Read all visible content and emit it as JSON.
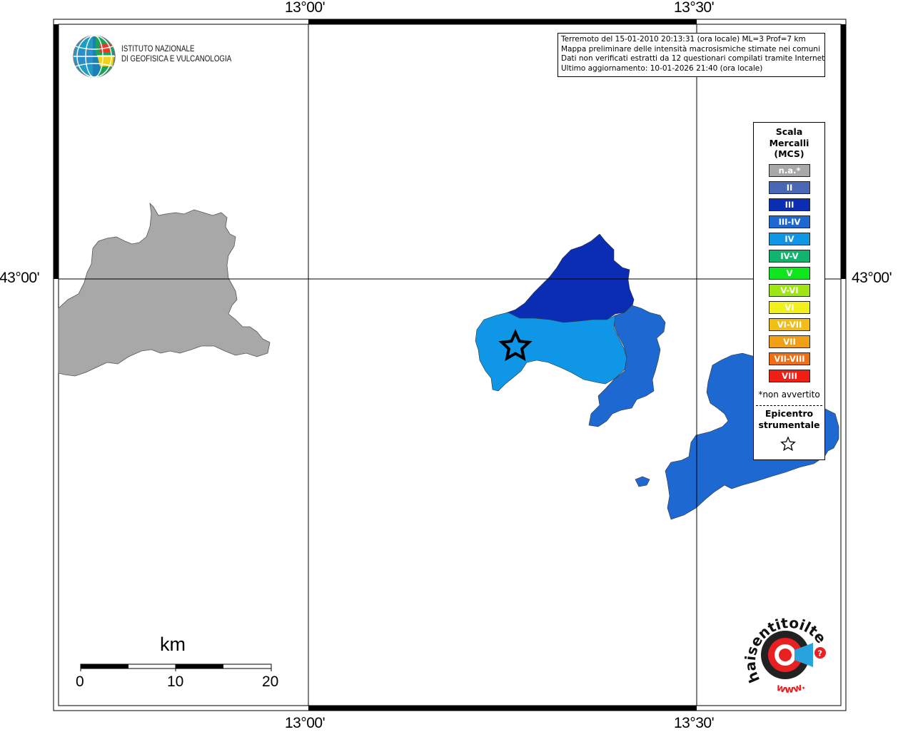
{
  "map": {
    "graticule": {
      "lon_labels": [
        "13°00'",
        "13°30'"
      ],
      "lat_labels": [
        "43°00'"
      ]
    },
    "colors": {
      "not_available": "#a8a8a8",
      "intensity_III": "#0a2db4",
      "intensity_III_IV": "#1e68d2",
      "intensity_IV": "#0f96e6",
      "epicenter_star": "#000000"
    },
    "regions": [
      {
        "name": "municipality-na",
        "intensity": "n.a."
      },
      {
        "name": "municipality-III",
        "intensity": "III"
      },
      {
        "name": "municipality-IV",
        "intensity": "IV"
      },
      {
        "name": "municipality-III-IV-east",
        "intensity": "III-IV"
      },
      {
        "name": "municipality-III-IV-southeast",
        "intensity": "III-IV"
      }
    ]
  },
  "info": {
    "line1": "Terremoto del 15-01-2010 20:13:31 (ora locale) ML=3 Prof=7 km",
    "line2": "Mappa preliminare delle intensità macrosismiche stimate nei comuni",
    "line3": "Dati non verificati estratti da 12 questionari compilati tramite Internet.",
    "line4": "Ultimo aggiornamento: 10-01-2026 21:40 (ora locale)"
  },
  "legend": {
    "title_line1": "Scala",
    "title_line2": "Mercalli",
    "title_line3": "(MCS)",
    "items": [
      {
        "label": "n.a.*",
        "color": "#a8a8a8"
      },
      {
        "label": "II",
        "color": "#4a67b5"
      },
      {
        "label": "III",
        "color": "#0a2db4"
      },
      {
        "label": "III-IV",
        "color": "#1e68d2"
      },
      {
        "label": "IV",
        "color": "#0f96e6"
      },
      {
        "label": "IV-V",
        "color": "#10b46e"
      },
      {
        "label": "V",
        "color": "#10e61e"
      },
      {
        "label": "V-VI",
        "color": "#a0e614"
      },
      {
        "label": "VI",
        "color": "#f0f01e"
      },
      {
        "label": "VI-VII",
        "color": "#f0be14"
      },
      {
        "label": "VII",
        "color": "#f0a014"
      },
      {
        "label": "VII-VIII",
        "color": "#f06e14"
      },
      {
        "label": "VIII",
        "color": "#f01e14"
      }
    ],
    "note": "*non avvertito",
    "epicenter_line1": "Epicentro",
    "epicenter_line2": "strumentale"
  },
  "logo": {
    "ingv_line1": "ISTITUTO NAZIONALE",
    "ingv_line2": "DI GEOFISICA E VULCANOLOGIA",
    "hst_text": "haisentitoilterremoto.it",
    "hst_www": "www."
  },
  "scalebar": {
    "unit": "km",
    "labels": [
      "0",
      "10",
      "20"
    ]
  }
}
